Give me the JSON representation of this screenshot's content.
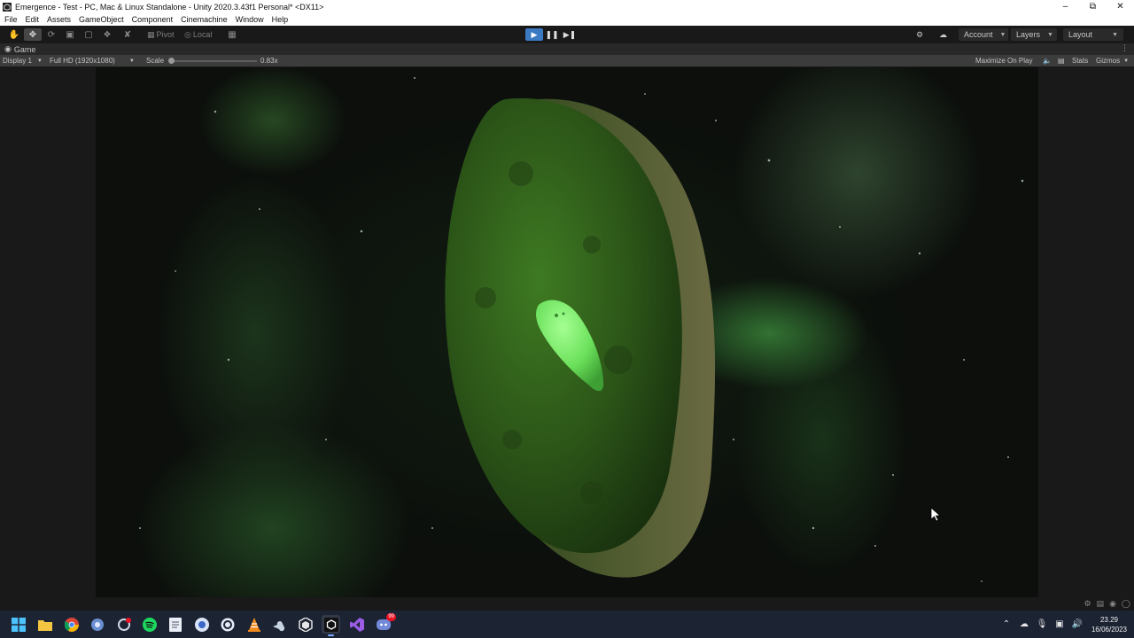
{
  "window": {
    "title": "Emergence - Test - PC, Mac & Linux Standalone - Unity 2020.3.43f1 Personal* <DX11>",
    "controls": [
      "minimize-icon",
      "restore-icon",
      "close-icon"
    ]
  },
  "menu": {
    "items": [
      "File",
      "Edit",
      "Assets",
      "GameObject",
      "Component",
      "Cinemachine",
      "Window",
      "Help"
    ]
  },
  "toolbar": {
    "tools": [
      "hand-tool-icon",
      "move-tool-icon",
      "rotate-tool-icon",
      "scale-tool-icon",
      "rect-tool-icon",
      "transform-tool-icon",
      "custom-tool-icon"
    ],
    "active_tool": "move-tool-icon",
    "pivot_label": "Pivot",
    "local_label": "Local",
    "play_state": "playing",
    "account_label": "Account",
    "layers_label": "Layers",
    "layout_label": "Layout",
    "accent_color": "#3b79c2"
  },
  "game_view": {
    "tab_label": "Game",
    "display_label": "Display 1",
    "resolution_label": "Full HD (1920x1080)",
    "scale_label": "Scale",
    "scale_value": "0.83x",
    "maximize_label": "Maximize On Play",
    "stats_label": "Stats",
    "gizmos_label": "Gizmos"
  },
  "scene": {
    "description_icons": [
      "asteroid",
      "green-creature",
      "mouse-cursor-icon"
    ],
    "nebula_color": "#4aa84a",
    "asteroid_color": "#3f6b24",
    "creature_color": "#6be05b"
  },
  "taskbar": {
    "icons": [
      "windows-start-icon",
      "file-explorer-icon",
      "chrome-icon",
      "app-icon-blue",
      "app-icon-red-dot",
      "spotify-icon",
      "notepad-icon",
      "steam-like-icon",
      "app-icon-circle",
      "vlc-icon",
      "steam-icon",
      "unity-hub-icon",
      "unity-icon",
      "visual-studio-icon",
      "discord-icon"
    ],
    "active_icon": "unity-icon",
    "discord_badge": "99",
    "tray_icons": [
      "chevron-up-icon",
      "onedrive-icon",
      "mic-icon",
      "network-icon",
      "volume-icon"
    ],
    "time": "23.29",
    "date": "16/06/2023"
  }
}
